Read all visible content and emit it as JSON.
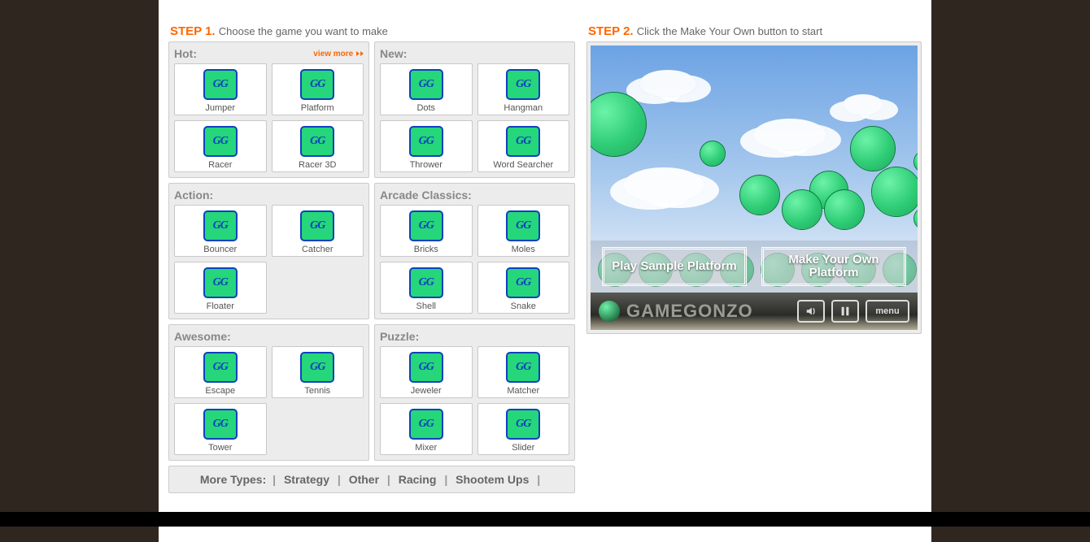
{
  "step1": {
    "title": "STEP 1.",
    "subtitle": "Choose the game you want to make"
  },
  "step2": {
    "title": "STEP 2.",
    "subtitle": "Click the Make Your Own button to start"
  },
  "view_more": "view more",
  "icon_text": "GG",
  "categories": [
    {
      "name": "Hot:",
      "viewmore": true,
      "games": [
        "Jumper",
        "Platform",
        "Racer",
        "Racer 3D"
      ]
    },
    {
      "name": "New:",
      "games": [
        "Dots",
        "Hangman",
        "Thrower",
        "Word Searcher"
      ]
    },
    {
      "name": "Action:",
      "games": [
        "Bouncer",
        "Catcher",
        "Floater"
      ]
    },
    {
      "name": "Arcade Classics:",
      "games": [
        "Bricks",
        "Moles",
        "Shell",
        "Snake"
      ]
    },
    {
      "name": "Awesome:",
      "games": [
        "Escape",
        "Tennis",
        "Tower"
      ]
    },
    {
      "name": "Puzzle:",
      "games": [
        "Jeweler",
        "Matcher",
        "Mixer",
        "Slider"
      ]
    }
  ],
  "more_types": {
    "label": "More Types:",
    "links": [
      "Strategy",
      "Other",
      "Racing",
      "Shootem Ups"
    ]
  },
  "preview": {
    "play_label": "Play Sample Platform",
    "make_label": "Make Your Own Platform",
    "brand": "GAMEGONZO",
    "menu_label": "menu"
  }
}
